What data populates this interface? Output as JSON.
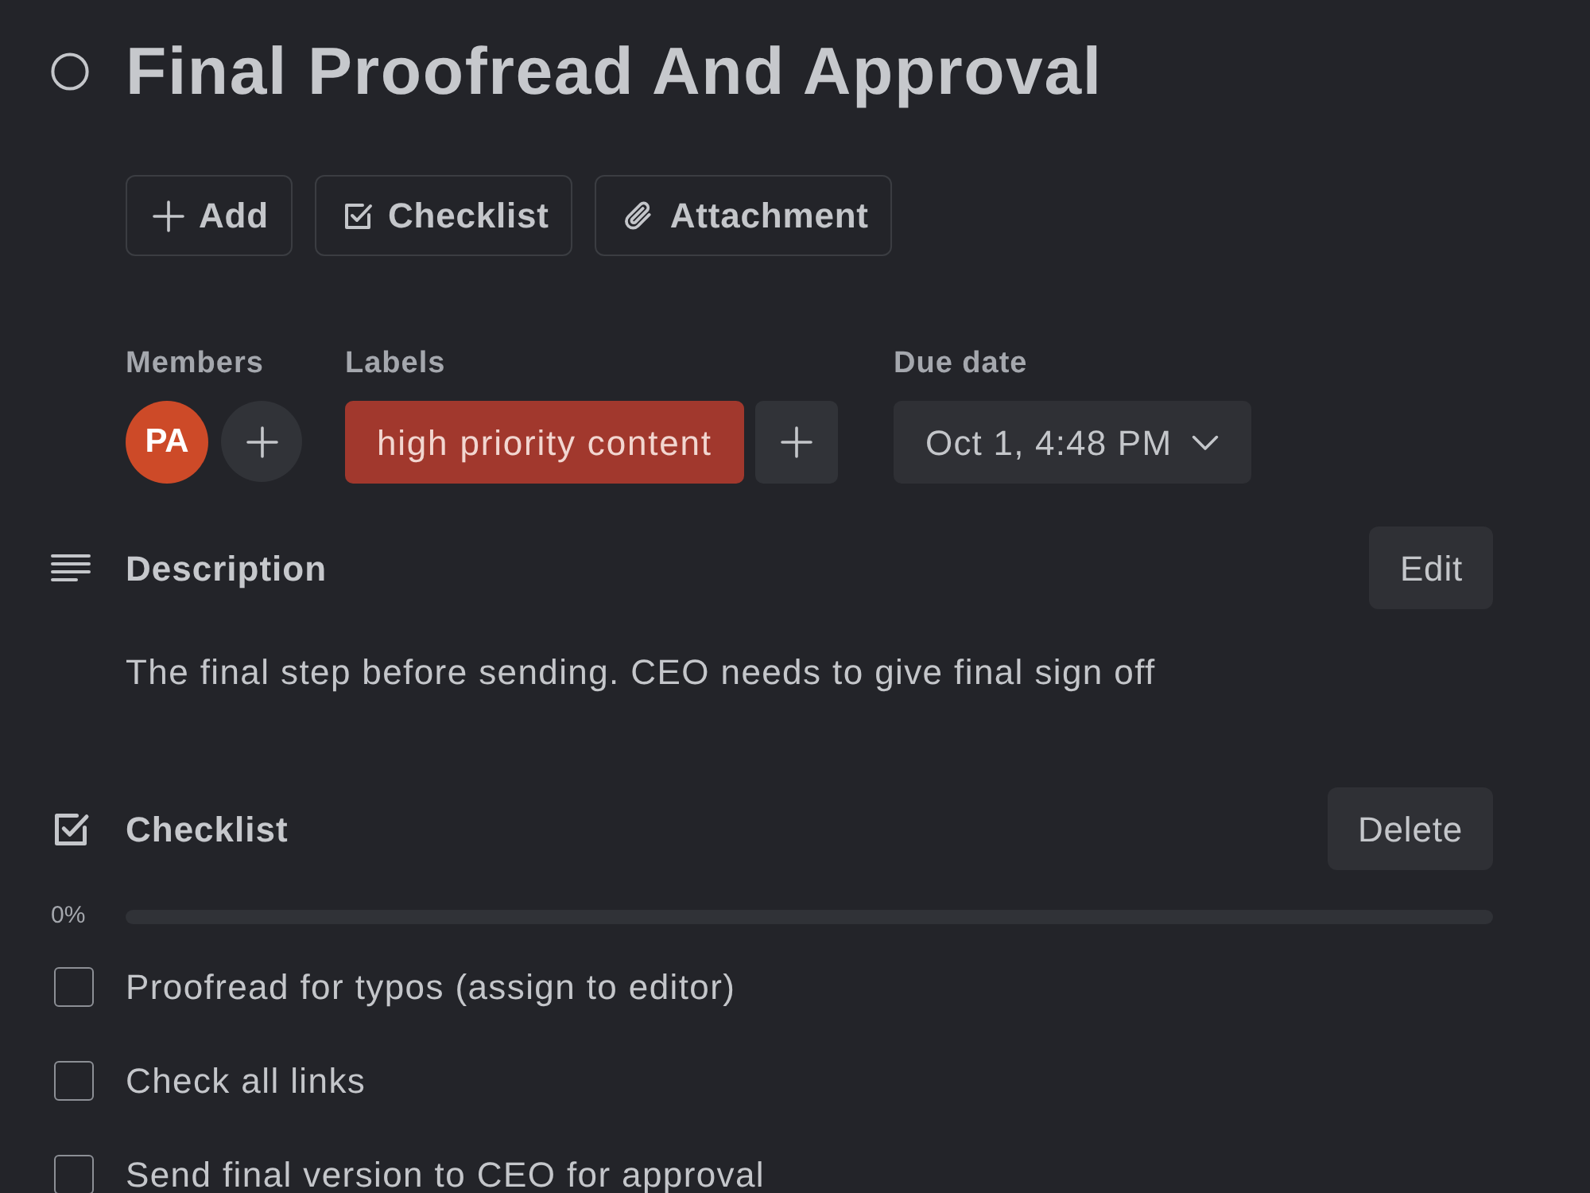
{
  "task": {
    "title": "Final Proofread And Approval",
    "completed": false
  },
  "actions": [
    {
      "kind": "add",
      "label": "Add"
    },
    {
      "kind": "checklist",
      "label": "Checklist"
    },
    {
      "kind": "attachment",
      "label": "Attachment"
    }
  ],
  "members": {
    "heading": "Members",
    "avatars": [
      {
        "initials": "PA",
        "color": "#cd4a28"
      }
    ]
  },
  "labels": {
    "heading": "Labels",
    "items": [
      {
        "text": "high priority content",
        "color": "#a1382d"
      }
    ]
  },
  "due_date": {
    "heading": "Due date",
    "value": "Oct 1, 4:48 PM"
  },
  "description": {
    "heading": "Description",
    "button": "Edit",
    "text": "The final step before sending. CEO needs to give final sign off"
  },
  "checklist": {
    "heading": "Checklist",
    "button": "Delete",
    "progress_text": "0%",
    "level": 0,
    "items": [
      {
        "text": "Proofread for typos (assign to editor)",
        "checked": false
      },
      {
        "text": "Check all links",
        "checked": false
      },
      {
        "text": "Send final version to CEO for approval",
        "checked": false
      }
    ]
  }
}
